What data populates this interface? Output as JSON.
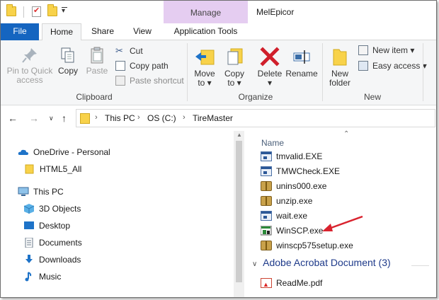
{
  "window": {
    "title": "MelEpicor",
    "contextual_tab_group": "Manage"
  },
  "quick_access": {
    "items": [
      "folder-icon",
      "properties-icon",
      "new-folder-icon",
      "customize-dropdown-icon"
    ]
  },
  "tabs": [
    {
      "label": "File"
    },
    {
      "label": "Home"
    },
    {
      "label": "Share"
    },
    {
      "label": "View"
    },
    {
      "label": "Application Tools"
    }
  ],
  "ribbon": {
    "clipboard": {
      "label": "Clipboard",
      "pin_label_1": "Pin to Quick",
      "pin_label_2": "access",
      "copy": "Copy",
      "paste": "Paste",
      "cut": "Cut",
      "copy_path": "Copy path",
      "paste_shortcut": "Paste shortcut"
    },
    "organize": {
      "label": "Organize",
      "move_to_1": "Move",
      "move_to_2": "to ▾",
      "copy_to_1": "Copy",
      "copy_to_2": "to ▾",
      "delete_1": "Delete",
      "delete_2": "▾",
      "rename": "Rename"
    },
    "new": {
      "label": "New",
      "new_folder_1": "New",
      "new_folder_2": "folder",
      "new_item": "New item ▾",
      "easy_access": "Easy access ▾"
    }
  },
  "address": {
    "crumbs": [
      "This PC",
      "OS (C:)",
      "TireMaster"
    ]
  },
  "nav_pane": {
    "items": [
      {
        "label": "OneDrive - Personal",
        "icon": "cloud-icon"
      },
      {
        "label": "HTML5_All",
        "icon": "folder-icon"
      },
      {
        "label": "This PC",
        "icon": "computer-icon"
      },
      {
        "label": "3D Objects",
        "icon": "cube-icon"
      },
      {
        "label": "Desktop",
        "icon": "desktop-icon"
      },
      {
        "label": "Documents",
        "icon": "document-icon"
      },
      {
        "label": "Downloads",
        "icon": "download-icon"
      },
      {
        "label": "Music",
        "icon": "music-icon"
      }
    ]
  },
  "file_list": {
    "column_name": "Name",
    "files": [
      {
        "name": "tmvalid.EXE",
        "icon": "exe-icon"
      },
      {
        "name": "TMWCheck.EXE",
        "icon": "exe-icon"
      },
      {
        "name": "unins000.exe",
        "icon": "installer-icon"
      },
      {
        "name": "unzip.exe",
        "icon": "installer-icon"
      },
      {
        "name": "wait.exe",
        "icon": "exe-icon"
      },
      {
        "name": "WinSCP.exe",
        "icon": "winscp-icon"
      },
      {
        "name": "winscp575setup.exe",
        "icon": "installer-icon"
      }
    ],
    "group": {
      "label": "Adobe Acrobat Document (3)"
    },
    "group_files": [
      {
        "name": "ReadMe.pdf",
        "icon": "pdf-icon"
      }
    ]
  },
  "annotation": {
    "color": "#d9232e"
  }
}
